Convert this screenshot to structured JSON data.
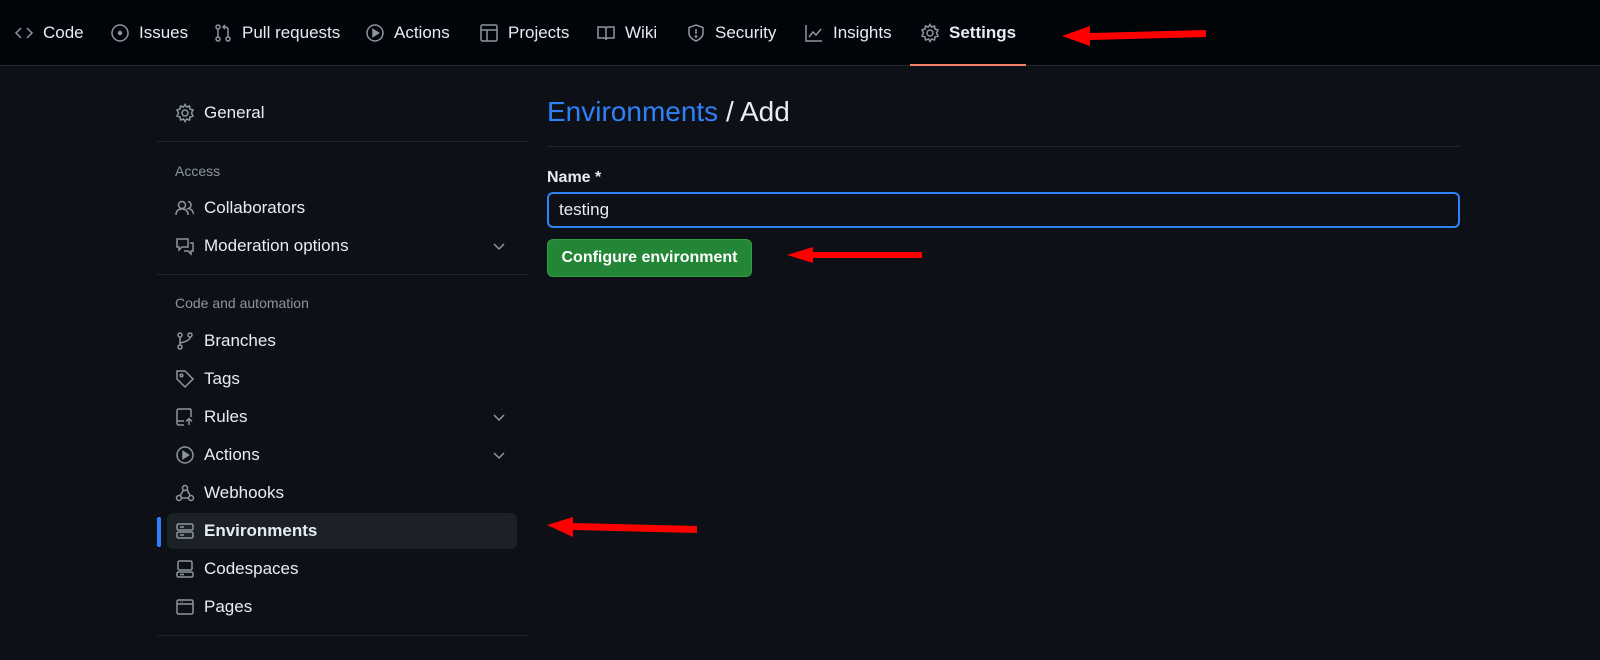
{
  "topnav": {
    "tabs": [
      {
        "label": "Code",
        "icon": "code-icon"
      },
      {
        "label": "Issues",
        "icon": "issue-icon"
      },
      {
        "label": "Pull requests",
        "icon": "pull-request-icon"
      },
      {
        "label": "Actions",
        "icon": "play-icon"
      },
      {
        "label": "Projects",
        "icon": "table-icon"
      },
      {
        "label": "Wiki",
        "icon": "book-icon"
      },
      {
        "label": "Security",
        "icon": "shield-icon"
      },
      {
        "label": "Insights",
        "icon": "graph-icon"
      },
      {
        "label": "Settings",
        "icon": "gear-icon",
        "active": true
      }
    ]
  },
  "sidebar": {
    "general": "General",
    "sections": [
      {
        "heading": "Access",
        "items": [
          "Collaborators",
          "Moderation options"
        ]
      },
      {
        "heading": "Code and automation",
        "items": [
          "Branches",
          "Tags",
          "Rules",
          "Actions",
          "Webhooks",
          "Environments",
          "Codespaces",
          "Pages"
        ]
      }
    ],
    "active_item": "Environments"
  },
  "main": {
    "breadcrumb_link": "Environments",
    "breadcrumb_sep": " / ",
    "breadcrumb_current": "Add",
    "name_label": "Name *",
    "name_value": "testing",
    "configure_button": "Configure environment"
  },
  "colors": {
    "accent": "#2f81f7",
    "primary_button": "#238636",
    "annotation_arrow": "#ff0000",
    "active_tab_underline": "#f78166"
  }
}
